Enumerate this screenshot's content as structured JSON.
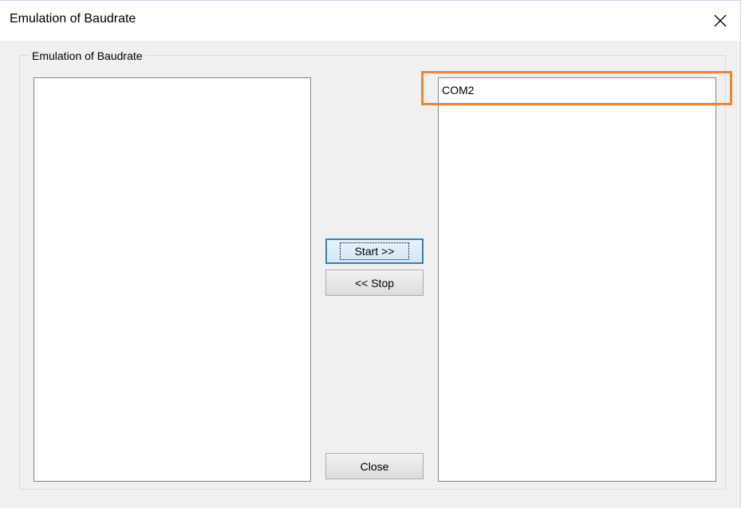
{
  "window": {
    "title": "Emulation of Baudrate",
    "close_icon": "close-icon"
  },
  "group": {
    "label": "Emulation of Baudrate"
  },
  "left_list": {
    "items": []
  },
  "right_list": {
    "items": [
      "COM2"
    ]
  },
  "buttons": {
    "start_label": "Start >>",
    "stop_label": "<< Stop",
    "close_label": "Close"
  },
  "colors": {
    "highlight": "#ec8536",
    "focus_border": "#3c7fb1"
  }
}
